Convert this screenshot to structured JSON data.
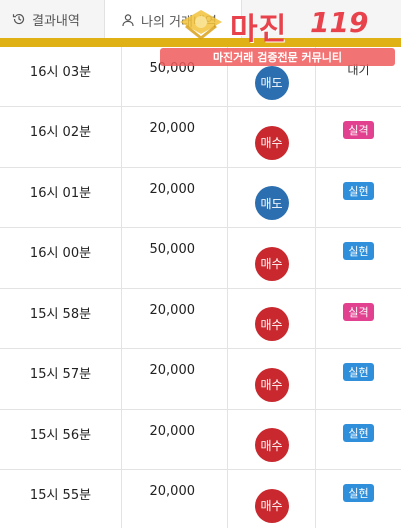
{
  "tabs": {
    "history_label": "결과내역",
    "mine_label": "나의 거래내역"
  },
  "logo": {
    "title": "마진",
    "number": "119",
    "tagline": "마진거래 검증전문 커뮤니티"
  },
  "colors": {
    "accent_gold": "#e0b114",
    "sell": "#2c6fb0",
    "buy": "#c8282e",
    "fail": "#e2418f",
    "success": "#2f8fdb"
  },
  "rows": [
    {
      "time": "16시 03분",
      "amount": "50,000",
      "side": "매도",
      "side_type": "sell",
      "result": "대기",
      "result_type": "wait"
    },
    {
      "time": "16시 02분",
      "amount": "20,000",
      "side": "매수",
      "side_type": "buy",
      "result": "실격",
      "result_type": "fail"
    },
    {
      "time": "16시 01분",
      "amount": "20,000",
      "side": "매도",
      "side_type": "sell",
      "result": "실현",
      "result_type": "ok"
    },
    {
      "time": "16시 00분",
      "amount": "50,000",
      "side": "매수",
      "side_type": "buy",
      "result": "실현",
      "result_type": "ok"
    },
    {
      "time": "15시 58분",
      "amount": "20,000",
      "side": "매수",
      "side_type": "buy",
      "result": "실격",
      "result_type": "fail"
    },
    {
      "time": "15시 57분",
      "amount": "20,000",
      "side": "매수",
      "side_type": "buy",
      "result": "실현",
      "result_type": "ok"
    },
    {
      "time": "15시 56분",
      "amount": "20,000",
      "side": "매수",
      "side_type": "buy",
      "result": "실현",
      "result_type": "ok"
    },
    {
      "time": "15시 55분",
      "amount": "20,000",
      "side": "매수",
      "side_type": "buy",
      "result": "실현",
      "result_type": "ok"
    }
  ]
}
